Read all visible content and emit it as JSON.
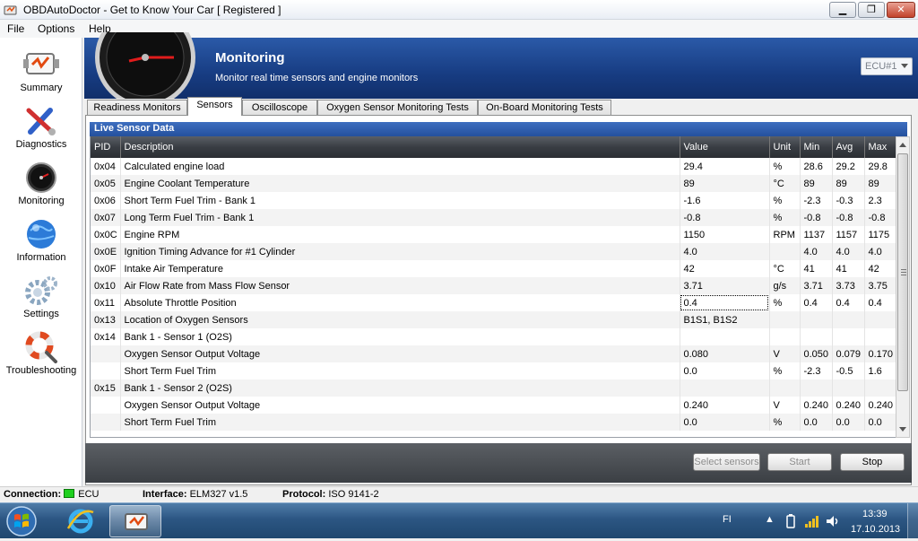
{
  "window": {
    "title": "OBDAutoDoctor - Get to Know Your Car [ Registered ]",
    "minimize_glyph": "▁",
    "maximize_glyph": "❐",
    "close_glyph": "✕"
  },
  "menu": [
    "File",
    "Options",
    "Help"
  ],
  "sidebar": {
    "items": [
      {
        "label": "Summary",
        "icon": "engine-check-icon"
      },
      {
        "label": "Diagnostics",
        "icon": "wrench-screwdriver-icon"
      },
      {
        "label": "Monitoring",
        "icon": "gauge-icon"
      },
      {
        "label": "Information",
        "icon": "globe-icon"
      },
      {
        "label": "Settings",
        "icon": "gears-icon"
      },
      {
        "label": "Troubleshooting",
        "icon": "lifebuoy-magnifier-icon"
      }
    ]
  },
  "header": {
    "title": "Monitoring",
    "subtitle": "Monitor real time sensors and engine monitors",
    "ecu_selected": "ECU#1"
  },
  "tabs": [
    {
      "label": "Readiness Monitors",
      "active": false
    },
    {
      "label": "Sensors",
      "active": true
    },
    {
      "label": "Oscilloscope",
      "active": false
    },
    {
      "label": "Oxygen Sensor Monitoring Tests",
      "active": false
    },
    {
      "label": "On-Board Monitoring Tests",
      "active": false
    }
  ],
  "sensors": {
    "section_title": "Live Sensor Data",
    "columns": [
      "PID",
      "Description",
      "Value",
      "Unit",
      "Min",
      "Avg",
      "Max"
    ],
    "rows": [
      [
        "0x04",
        "Calculated engine load",
        "29.4",
        "%",
        "28.6",
        "29.2",
        "29.8"
      ],
      [
        "0x05",
        "Engine Coolant Temperature",
        "89",
        "°C",
        "89",
        "89",
        "89"
      ],
      [
        "0x06",
        "Short Term Fuel Trim - Bank 1",
        "-1.6",
        "%",
        "-2.3",
        "-0.3",
        "2.3"
      ],
      [
        "0x07",
        "Long Term Fuel Trim - Bank 1",
        "-0.8",
        "%",
        "-0.8",
        "-0.8",
        "-0.8"
      ],
      [
        "0x0C",
        "Engine RPM",
        "1150",
        "RPM",
        "1137",
        "1157",
        "1175"
      ],
      [
        "0x0E",
        "Ignition Timing Advance for #1 Cylinder",
        "4.0",
        "",
        "4.0",
        "4.0",
        "4.0"
      ],
      [
        "0x0F",
        "Intake Air Temperature",
        "42",
        "°C",
        "41",
        "41",
        "42"
      ],
      [
        "0x10",
        "Air Flow Rate from Mass Flow Sensor",
        "3.71",
        "g/s",
        "3.71",
        "3.73",
        "3.75"
      ],
      [
        "0x11",
        "Absolute Throttle Position",
        "0.4",
        "%",
        "0.4",
        "0.4",
        "0.4"
      ],
      [
        "0x13",
        "Location of Oxygen Sensors",
        "B1S1, B1S2",
        "",
        "",
        "",
        ""
      ],
      [
        "0x14",
        "Bank 1 - Sensor 1 (O2S)",
        "",
        "",
        "",
        "",
        ""
      ],
      [
        "",
        "Oxygen Sensor Output Voltage",
        "0.080",
        "V",
        "0.050",
        "0.079",
        "0.170"
      ],
      [
        "",
        "Short Term Fuel Trim",
        "0.0",
        "%",
        "-2.3",
        "-0.5",
        "1.6"
      ],
      [
        "0x15",
        "Bank 1 - Sensor 2 (O2S)",
        "",
        "",
        "",
        "",
        ""
      ],
      [
        "",
        "Oxygen Sensor Output Voltage",
        "0.240",
        "V",
        "0.240",
        "0.240",
        "0.240"
      ],
      [
        "",
        "Short Term Fuel Trim",
        "0.0",
        "%",
        "0.0",
        "0.0",
        "0.0"
      ]
    ],
    "selected_row": 8
  },
  "actions": {
    "select_sensors": "Select sensors",
    "start": "Start",
    "stop": "Stop"
  },
  "status": {
    "connection_label": "Connection:",
    "connection_value": "ECU",
    "connection_color": "#1fd01f",
    "interface_label": "Interface:",
    "interface_value": "ELM327 v1.5",
    "protocol_label": "Protocol:",
    "protocol_value": "ISO 9141-2"
  },
  "taskbar": {
    "language": "FI",
    "time": "13:39",
    "date": "17.10.2013"
  }
}
